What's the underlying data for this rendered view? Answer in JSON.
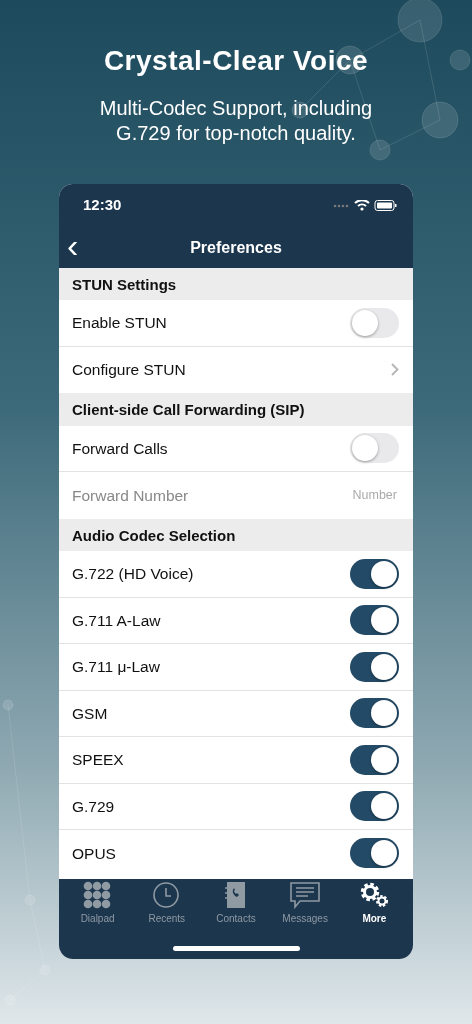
{
  "headline": "Crystal-Clear Voice",
  "subheadline": "Multi-Codec Support, including G.729 for top-notch quality.",
  "status_bar": {
    "time": "12:30"
  },
  "nav_bar": {
    "back": "‹",
    "title": "Preferences"
  },
  "sections": [
    {
      "title": "STUN Settings",
      "rows": [
        {
          "kind": "toggle",
          "label": "Enable STUN",
          "on": false
        },
        {
          "kind": "link",
          "label": "Configure STUN"
        }
      ]
    },
    {
      "title": "Client-side Call Forwarding (SIP)",
      "rows": [
        {
          "kind": "toggle",
          "label": "Forward Calls",
          "on": false
        },
        {
          "kind": "field",
          "label": "Forward Number",
          "placeholder": "Number"
        }
      ]
    },
    {
      "title": "Audio Codec Selection",
      "rows": [
        {
          "kind": "toggle",
          "label": "G.722 (HD Voice)",
          "on": true
        },
        {
          "kind": "toggle",
          "label": "G.711 A-Law",
          "on": true
        },
        {
          "kind": "toggle",
          "label": "G.711 μ-Law",
          "on": true
        },
        {
          "kind": "toggle",
          "label": "GSM",
          "on": true
        },
        {
          "kind": "toggle",
          "label": "SPEEX",
          "on": true
        },
        {
          "kind": "toggle",
          "label": "G.729",
          "on": true
        },
        {
          "kind": "toggle",
          "label": "OPUS",
          "on": true
        }
      ]
    }
  ],
  "tab_bar": [
    {
      "kind": "dialpad",
      "label": "Dialpad",
      "selected": false
    },
    {
      "kind": "recents",
      "label": "Recents",
      "selected": false
    },
    {
      "kind": "contacts",
      "label": "Contacts",
      "selected": false
    },
    {
      "kind": "messages",
      "label": "Messages",
      "selected": false
    },
    {
      "kind": "more",
      "label": "More",
      "selected": true
    }
  ]
}
